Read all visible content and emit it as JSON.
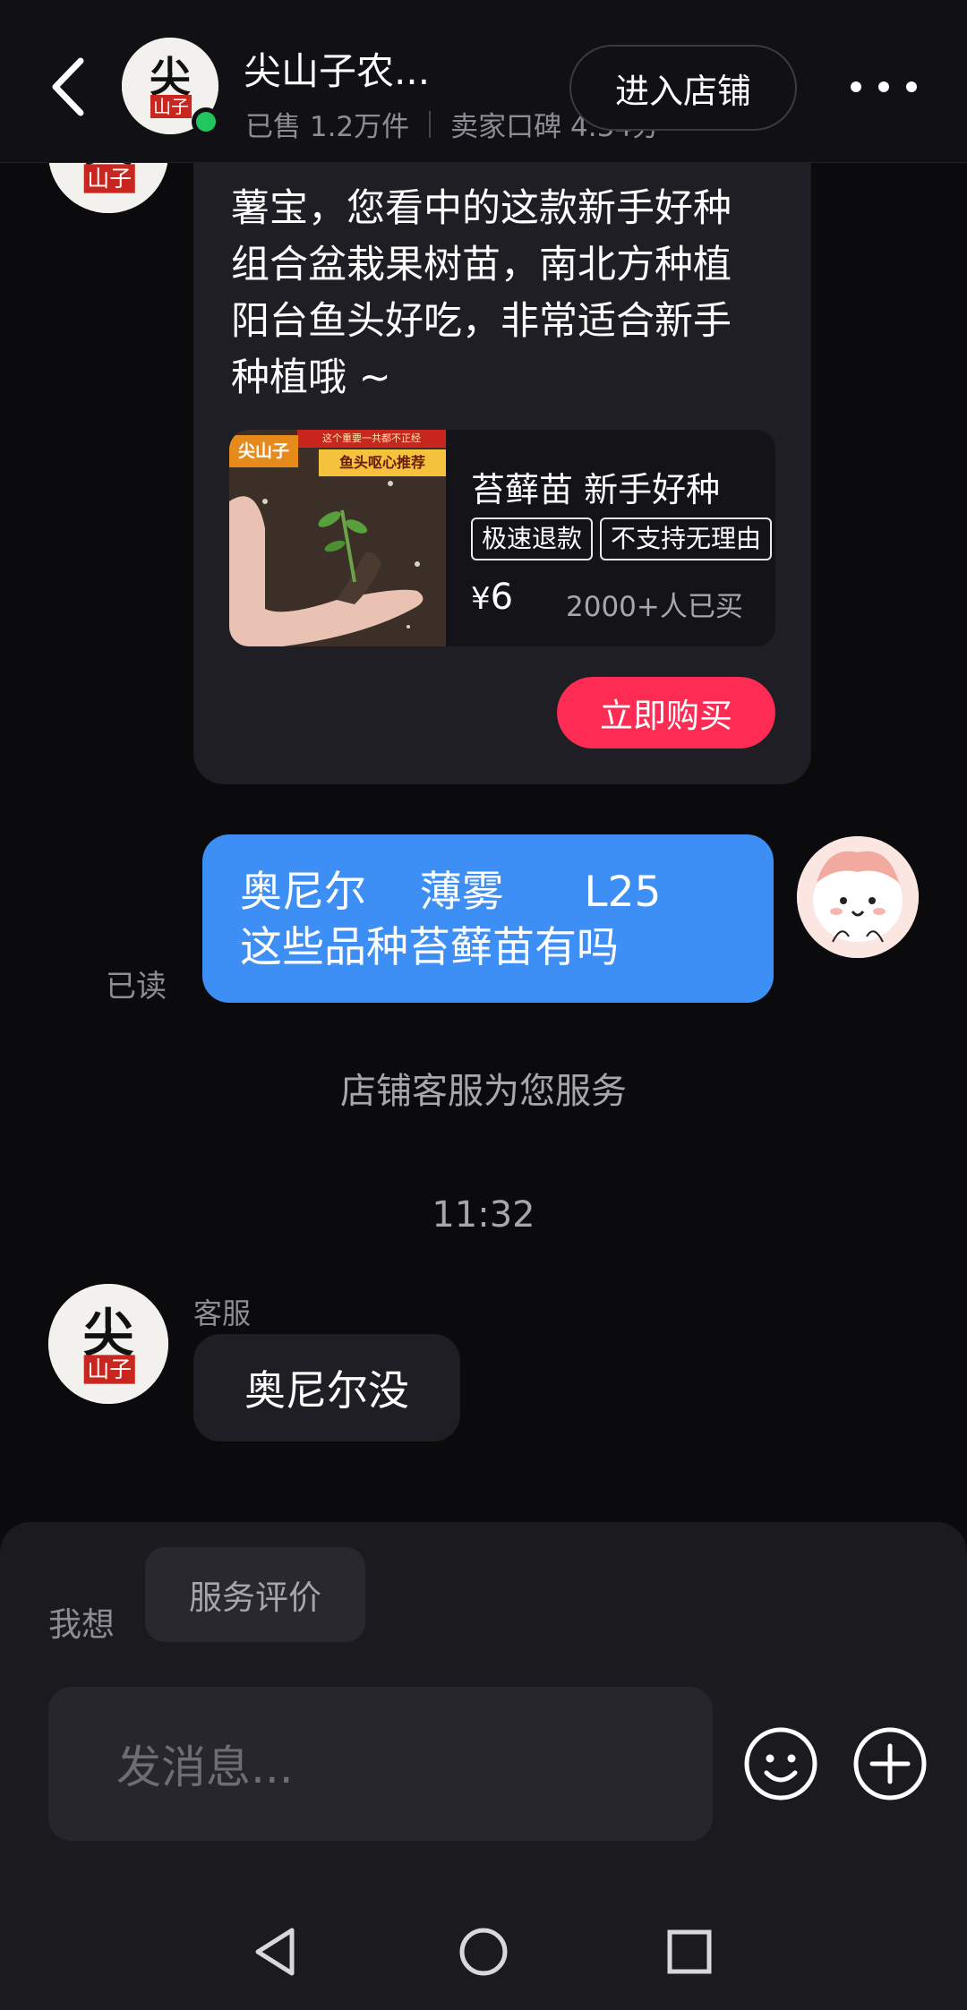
{
  "header": {
    "shop_name": "尖山子农...",
    "sold": "已售 1.2万件",
    "rating": "卖家口碑 4.34分",
    "enter_store": "进入店铺",
    "avatar_logo": "尖山子",
    "status_color": "#22c55e"
  },
  "messages": {
    "product_share": {
      "text": "薯宝，您看中的这款新手好种组合盆栽果树苗，南北方种植阳台鱼头好吃，非常适合新手种植哦 ~",
      "product": {
        "thumb_brand": "尖山子",
        "thumb_banner_top": "这个重要一共都不正经",
        "thumb_banner": "鱼头呕心推荐",
        "title": "苔藓苗 新手好种",
        "tags": [
          "极速退款",
          "不支持无理由"
        ],
        "currency": "¥",
        "price": "6",
        "sold": "2000+人已买"
      },
      "buy_button": "立即购买"
    },
    "user_message": {
      "line1": "奥尼尔    薄雾      L25",
      "line2": "这些品种苔藓苗有吗",
      "read_status": "已读"
    },
    "system_notice": "店铺客服为您服务",
    "timestamp": "11:32",
    "agent_reply": {
      "label": "客服",
      "text": "奥尼尔没"
    }
  },
  "composer": {
    "quick_label": "我想",
    "quick_chip": "服务评价",
    "placeholder": "发消息...",
    "emoji_icon": "smiley-icon",
    "plus_icon": "plus-circle-icon"
  },
  "colors": {
    "user_bubble": "#3d8ff5",
    "buy_button": "#fe2c55",
    "background": "#0b0b0d"
  }
}
